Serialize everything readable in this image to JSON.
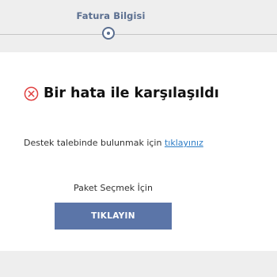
{
  "stepper": {
    "step_label": "Fatura Bilgisi"
  },
  "error": {
    "icon": "circle-x-icon",
    "title": "Bir hata ile karşılaşıldı"
  },
  "support": {
    "text": "Destek talebinde bulunmak için ",
    "link_label": "tıklayınız"
  },
  "package": {
    "label": "Paket Seçmek İçin",
    "button_label": "TIKLAYIN"
  },
  "colors": {
    "accent": "#5b6f90",
    "button": "#5b75a8",
    "error": "#e04040",
    "link": "#2d7dc6"
  }
}
